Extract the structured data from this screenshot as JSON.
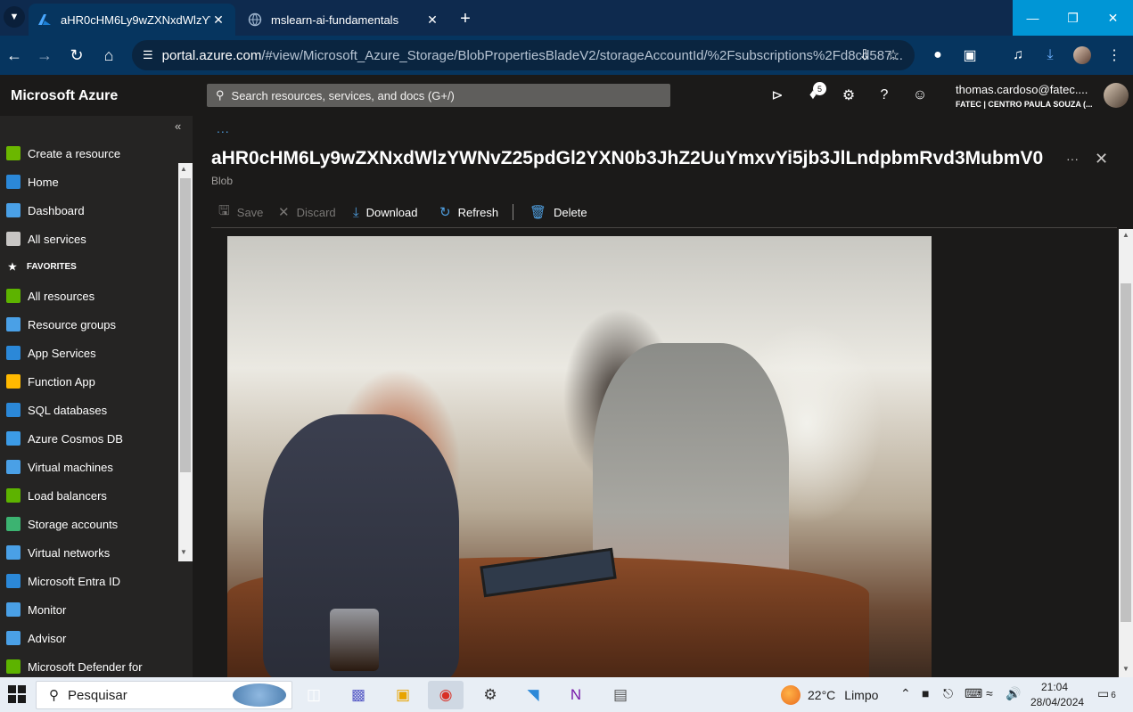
{
  "browser": {
    "tabs": [
      {
        "title": "aHR0cHM6Ly9wZXNxdWlzYWNvZ25pdGl2YXN0b3JhZ2UuYmxvYi5jb3JlLndpbmRvd3MubmV0",
        "active": true
      },
      {
        "title": "mslearn-ai-fundamentals",
        "active": false
      }
    ],
    "url_host": "portal.azure.com",
    "url_path": "/#view/Microsoft_Azure_Storage/BlobPropertiesBladeV2/storageAccountId/%2Fsubscriptions%2Fd8cd587..."
  },
  "azure": {
    "brand": "Microsoft Azure",
    "search_placeholder": "Search resources, services, and docs (G+/)",
    "notification_count": "5",
    "user_email": "thomas.cardoso@fatec....",
    "user_org": "FATEC | CENTRO PAULA SOUZA (..."
  },
  "sidebar": {
    "collapse_glyph": "«",
    "top_items": [
      {
        "label": "Create a resource",
        "icon": "plus-icon",
        "color": "#6bb700"
      },
      {
        "label": "Home",
        "icon": "home-icon",
        "color": "#2b88d8"
      },
      {
        "label": "Dashboard",
        "icon": "dashboard-icon",
        "color": "#4aa0e6"
      },
      {
        "label": "All services",
        "icon": "list-icon",
        "color": "#c8c6c4"
      }
    ],
    "favorites_label": "FAVORITES",
    "favorites": [
      {
        "label": "All resources",
        "icon": "grid-icon",
        "color": "#5db300"
      },
      {
        "label": "Resource groups",
        "icon": "cube-icon",
        "color": "#4aa0e6"
      },
      {
        "label": "App Services",
        "icon": "globe-icon",
        "color": "#2b88d8"
      },
      {
        "label": "Function App",
        "icon": "bolt-icon",
        "color": "#ffb900"
      },
      {
        "label": "SQL databases",
        "icon": "sql-icon",
        "color": "#2b88d8"
      },
      {
        "label": "Azure Cosmos DB",
        "icon": "planet-icon",
        "color": "#3c9be6"
      },
      {
        "label": "Virtual machines",
        "icon": "monitor-icon",
        "color": "#4aa0e6"
      },
      {
        "label": "Load balancers",
        "icon": "diamond-icon",
        "color": "#5db300"
      },
      {
        "label": "Storage accounts",
        "icon": "storage-icon",
        "color": "#3cb371"
      },
      {
        "label": "Virtual networks",
        "icon": "network-icon",
        "color": "#4aa0e6"
      },
      {
        "label": "Microsoft Entra ID",
        "icon": "entra-icon",
        "color": "#2b88d8"
      },
      {
        "label": "Monitor",
        "icon": "gauge-icon",
        "color": "#4aa0e6"
      },
      {
        "label": "Advisor",
        "icon": "cloud-icon",
        "color": "#4aa0e6"
      },
      {
        "label": "Microsoft Defender for",
        "icon": "shield-icon",
        "color": "#5db300"
      }
    ]
  },
  "blade": {
    "breadcrumb": "...",
    "title": "aHR0cHM6Ly9wZXNxdWlzYWNvZ25pdGl2YXN0b3JhZ2UuYmxvYi5jb3JlLndpbmRvd3MubmV0...",
    "title_display": "aHR0cHM6Ly9wZXNxdWlzYWNvZ25pdGl2YXN0b3JhZ2UuYmxvYi5jb3JlLndpbmRvd3MubmV0",
    "subtitle": "Blob",
    "more": "···",
    "commands": {
      "save": "Save",
      "discard": "Discard",
      "download": "Download",
      "refresh": "Refresh",
      "delete": "Delete"
    }
  },
  "taskbar": {
    "search_label": "Pesquisar",
    "weather_badge": "1",
    "weather_temp": "22°C",
    "weather_desc": "Limpo",
    "time": "21:04",
    "date": "28/04/2024",
    "notifications": "6"
  }
}
